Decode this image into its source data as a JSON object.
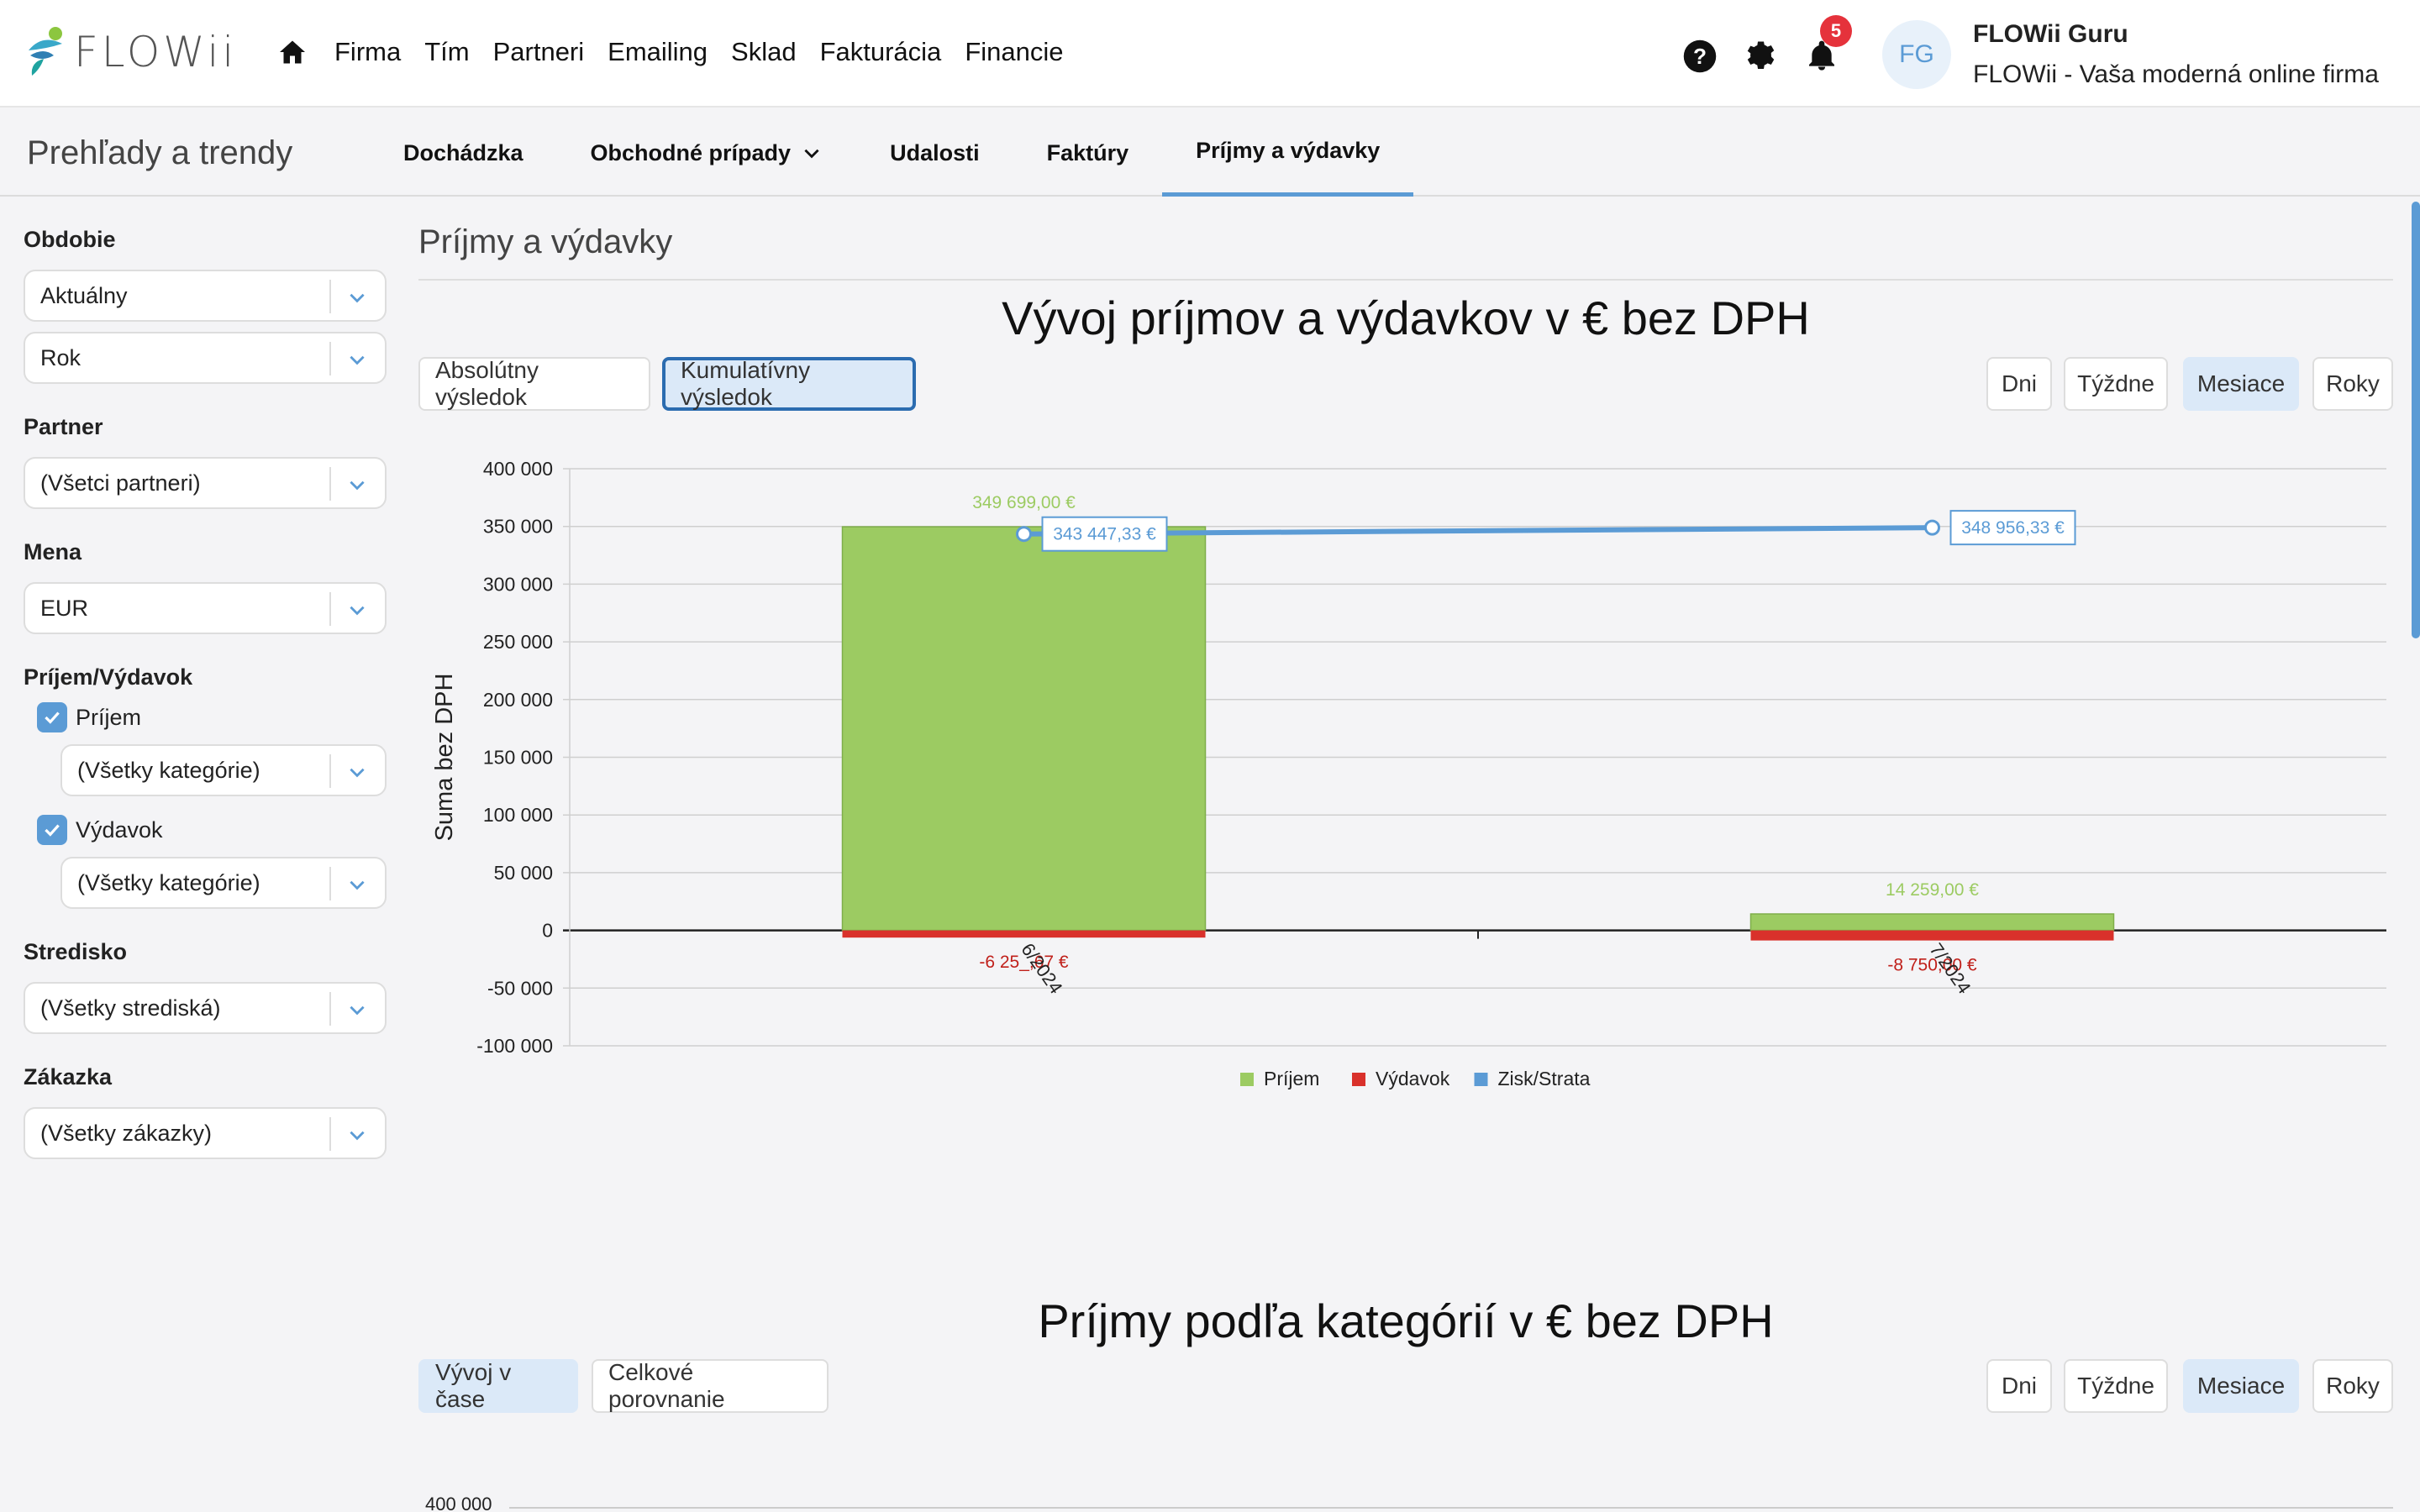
{
  "app": {
    "logo_text": "FLOWii"
  },
  "nav": {
    "items": [
      "Firma",
      "Tím",
      "Partneri",
      "Emailing",
      "Sklad",
      "Fakturácia",
      "Financie"
    ]
  },
  "header": {
    "notifications_count": "5",
    "avatar_initials": "FG",
    "user_name": "FLOWii Guru",
    "company": "FLOWii - Vaša moderná online firma"
  },
  "subnav": {
    "title": "Prehľady a trendy",
    "tabs": [
      "Dochádzka",
      "Obchodné prípady",
      "Udalosti",
      "Faktúry",
      "Príjmy a výdavky"
    ],
    "active_tab": "Príjmy a výdavky"
  },
  "filters": {
    "period_label": "Obdobie",
    "period_value": "Aktuálny",
    "period_unit": "Rok",
    "partner_label": "Partner",
    "partner_value": "(Všetci partneri)",
    "currency_label": "Mena",
    "currency_value": "EUR",
    "inout_label": "Príjem/Výdavok",
    "income_label": "Príjem",
    "income_checked": true,
    "income_category": "(Všetky kategórie)",
    "expense_label": "Výdavok",
    "expense_checked": true,
    "expense_category": "(Všetky kategórie)",
    "center_label": "Stredisko",
    "center_value": "(Všetky strediská)",
    "order_label": "Zákazka",
    "order_value": "(Všetky zákazky)"
  },
  "main": {
    "section_title": "Príjmy a výdavky",
    "chart1": {
      "title": "Vývoj príjmov a výdavkov v € bez DPH",
      "mode_buttons": [
        "Absolútny výsledok",
        "Kumulatívny výsledok"
      ],
      "period_buttons": [
        "Dni",
        "Týždne",
        "Mesiace",
        "Roky"
      ]
    },
    "chart2": {
      "title": "Príjmy podľa kategórií v € bez DPH",
      "mode_buttons": [
        "Vývoj v čase",
        "Celkové porovnanie"
      ],
      "period_buttons": [
        "Dni",
        "Týždne",
        "Mesiace",
        "Roky"
      ],
      "first_tick": "400 000"
    }
  },
  "colors": {
    "accent": "#5b9bd5",
    "income": "#9ccb62",
    "expense": "#d9312b",
    "profit": "#5b9bd5"
  },
  "chart_data": {
    "type": "bar",
    "title": "Vývoj príjmov a výdavkov v € bez DPH",
    "ylabel": "Suma bez DPH",
    "xlabel": "",
    "ylim": [
      -100000,
      400000
    ],
    "yticks": [
      "400 000",
      "350 000",
      "300 000",
      "250 000",
      "200 000",
      "150 000",
      "100 000",
      "50 000",
      "0",
      "-50 000",
      "-100 000"
    ],
    "categories": [
      "6/2024",
      "7/2024"
    ],
    "series": [
      {
        "name": "Príjem",
        "type": "bar",
        "values": [
          349699.0
        ],
        "labels": [
          "349 699,00 €",
          "14 259,00 €"
        ],
        "all_values": [
          349699.0,
          14259.0
        ]
      },
      {
        "name": "Výdavok",
        "type": "bar",
        "values": [
          -6251.67,
          -8750.0
        ],
        "labels": [
          "-6 25_,67 €",
          "-8 750,00 €"
        ]
      },
      {
        "name": "Zisk/Strata",
        "type": "line",
        "values": [
          343447.33,
          348956.33
        ],
        "labels": [
          "343 447,33 €",
          "348 956,33 €"
        ]
      }
    ],
    "legend": [
      "Príjem",
      "Výdavok",
      "Zisk/Strata"
    ],
    "legend_position": "bottom",
    "grid": true
  }
}
